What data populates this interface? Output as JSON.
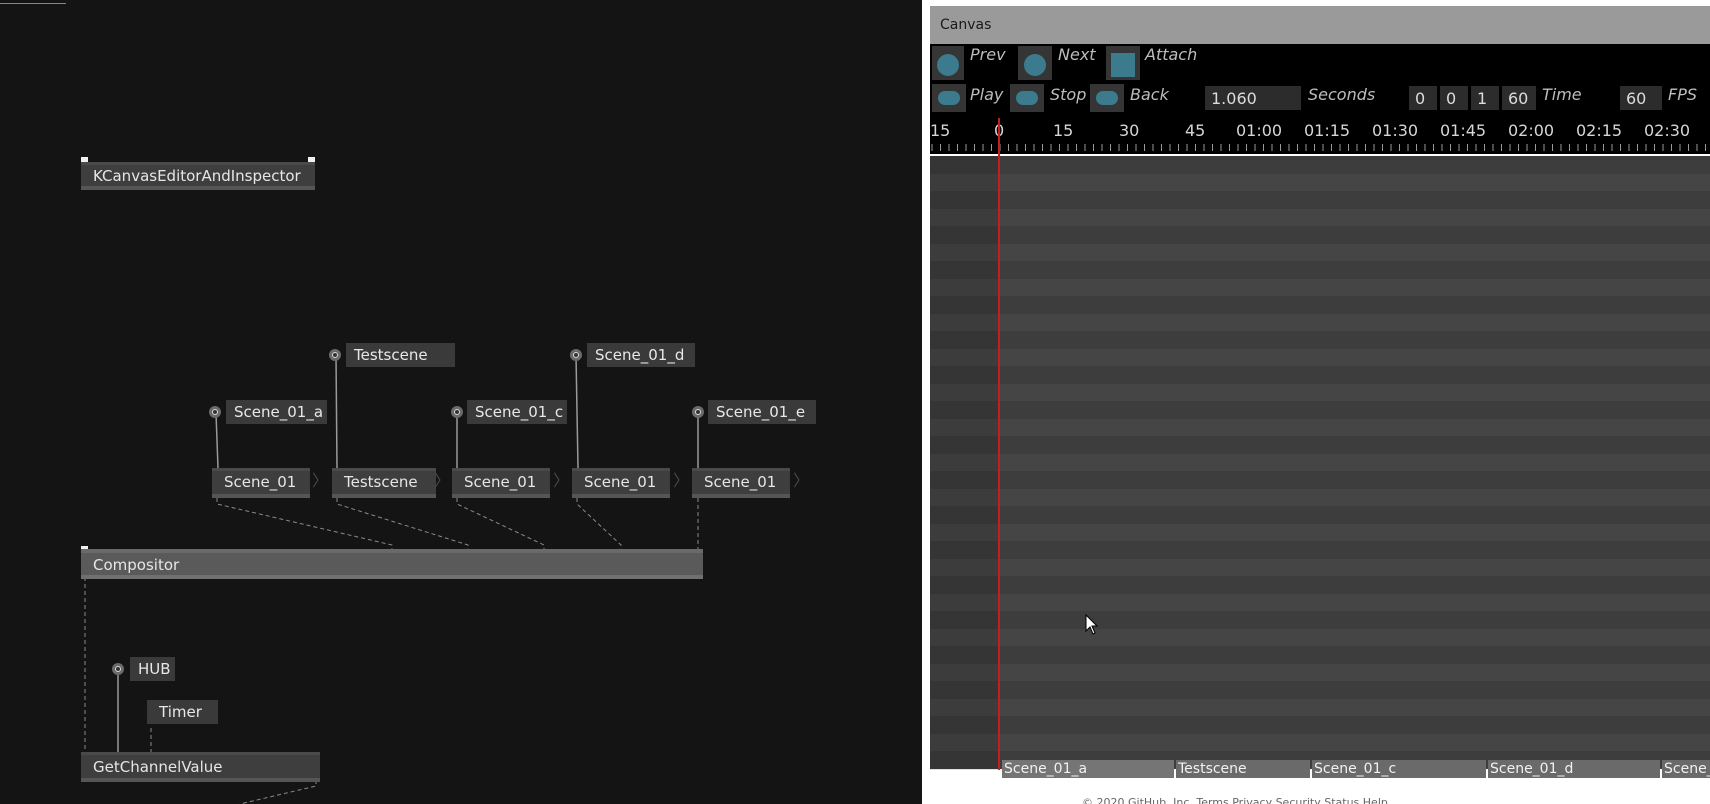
{
  "patch": {
    "inspector_node": "KCanvasEditorAndInspector",
    "compositor_node": "Compositor",
    "getchannel_node": "GetChannelValue",
    "timer_node": "Timer",
    "hub_label": "HUB",
    "inputs": [
      {
        "label": "Testscene"
      },
      {
        "label": "Scene_01_d"
      },
      {
        "label": "Scene_01_a"
      },
      {
        "label": "Scene_01_c"
      },
      {
        "label": "Scene_01_e"
      }
    ],
    "scene_nodes": [
      {
        "label": "Scene_01"
      },
      {
        "label": "Testscene"
      },
      {
        "label": "Scene_01"
      },
      {
        "label": "Scene_01"
      },
      {
        "label": "Scene_01"
      }
    ],
    "chevron": "〉"
  },
  "canvas_window": {
    "title": "Canvas",
    "toolbar": {
      "prev": "Prev",
      "next": "Next",
      "attach": "Attach",
      "play": "Play",
      "stop": "Stop",
      "back": "Back",
      "seconds_value": "1.060",
      "seconds_label": "Seconds",
      "time_fields": [
        "0",
        "0",
        "1",
        "60"
      ],
      "time_label": "Time",
      "fps_value": "60",
      "fps_label": "FPS"
    },
    "ruler_ticks": [
      "15",
      "0",
      "15",
      "30",
      "45",
      "01:00",
      "01:15",
      "01:30",
      "01:45",
      "02:00",
      "02:15",
      "02:30"
    ],
    "clips": [
      "Scene_01_a",
      "Testscene",
      "Scene_01_c",
      "Scene_01_d",
      "Scene_"
    ],
    "footer_text": "© 2020 GitHub, Inc.    Terms    Privacy    Security    Status    Help"
  },
  "colors": {
    "accent_teal": "#3c7a8e",
    "playhead_red": "#c41f1f",
    "track_dark": "#3d3d3d",
    "track_light": "#454545"
  }
}
